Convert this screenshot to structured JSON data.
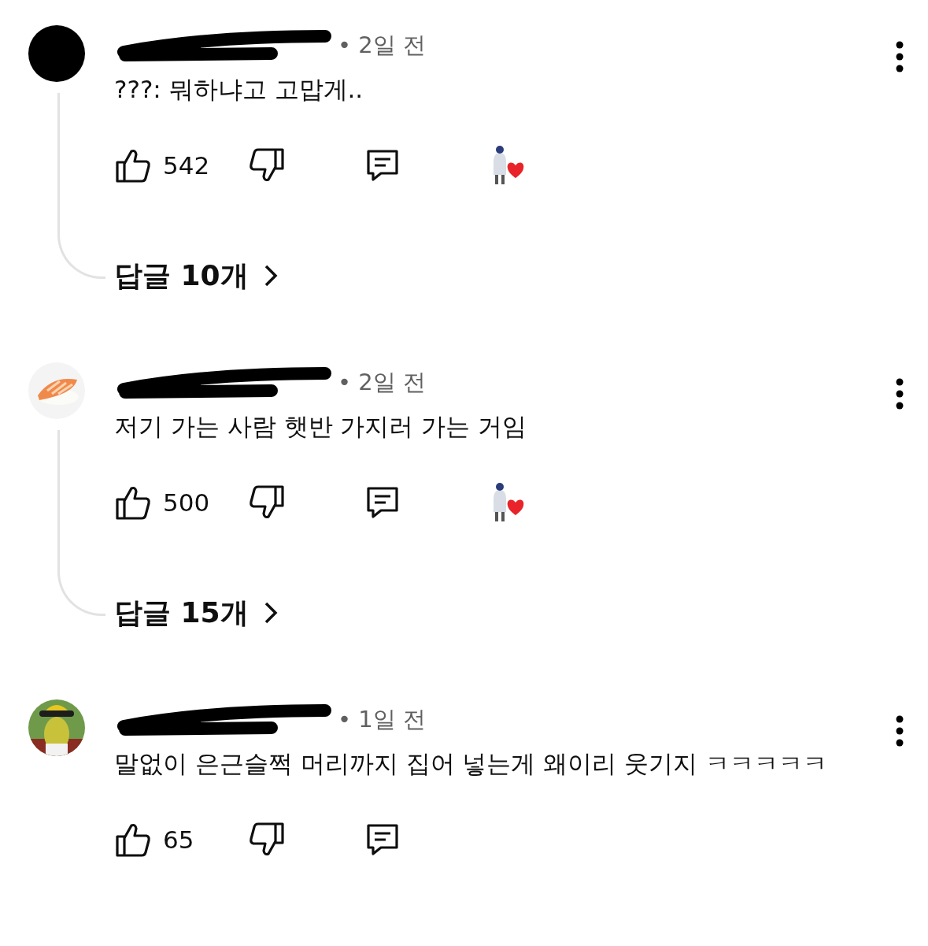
{
  "comments": [
    {
      "time": "• 2일 전",
      "text": "???: 뭐하냐고 고맙게..",
      "likes": "542",
      "hearted": true,
      "replies": "답글 10개"
    },
    {
      "time": "• 2일 전",
      "text": "저기 가는 사람 햇반 가지러 가는 거임",
      "likes": "500",
      "hearted": true,
      "replies": "답글 15개"
    },
    {
      "time": "• 1일 전",
      "text": "말없이 은근슬쩍 머리까지 집어 넣는게 왜이리 웃기지 ㅋㅋㅋㅋㅋ",
      "likes": "65",
      "hearted": false
    }
  ]
}
